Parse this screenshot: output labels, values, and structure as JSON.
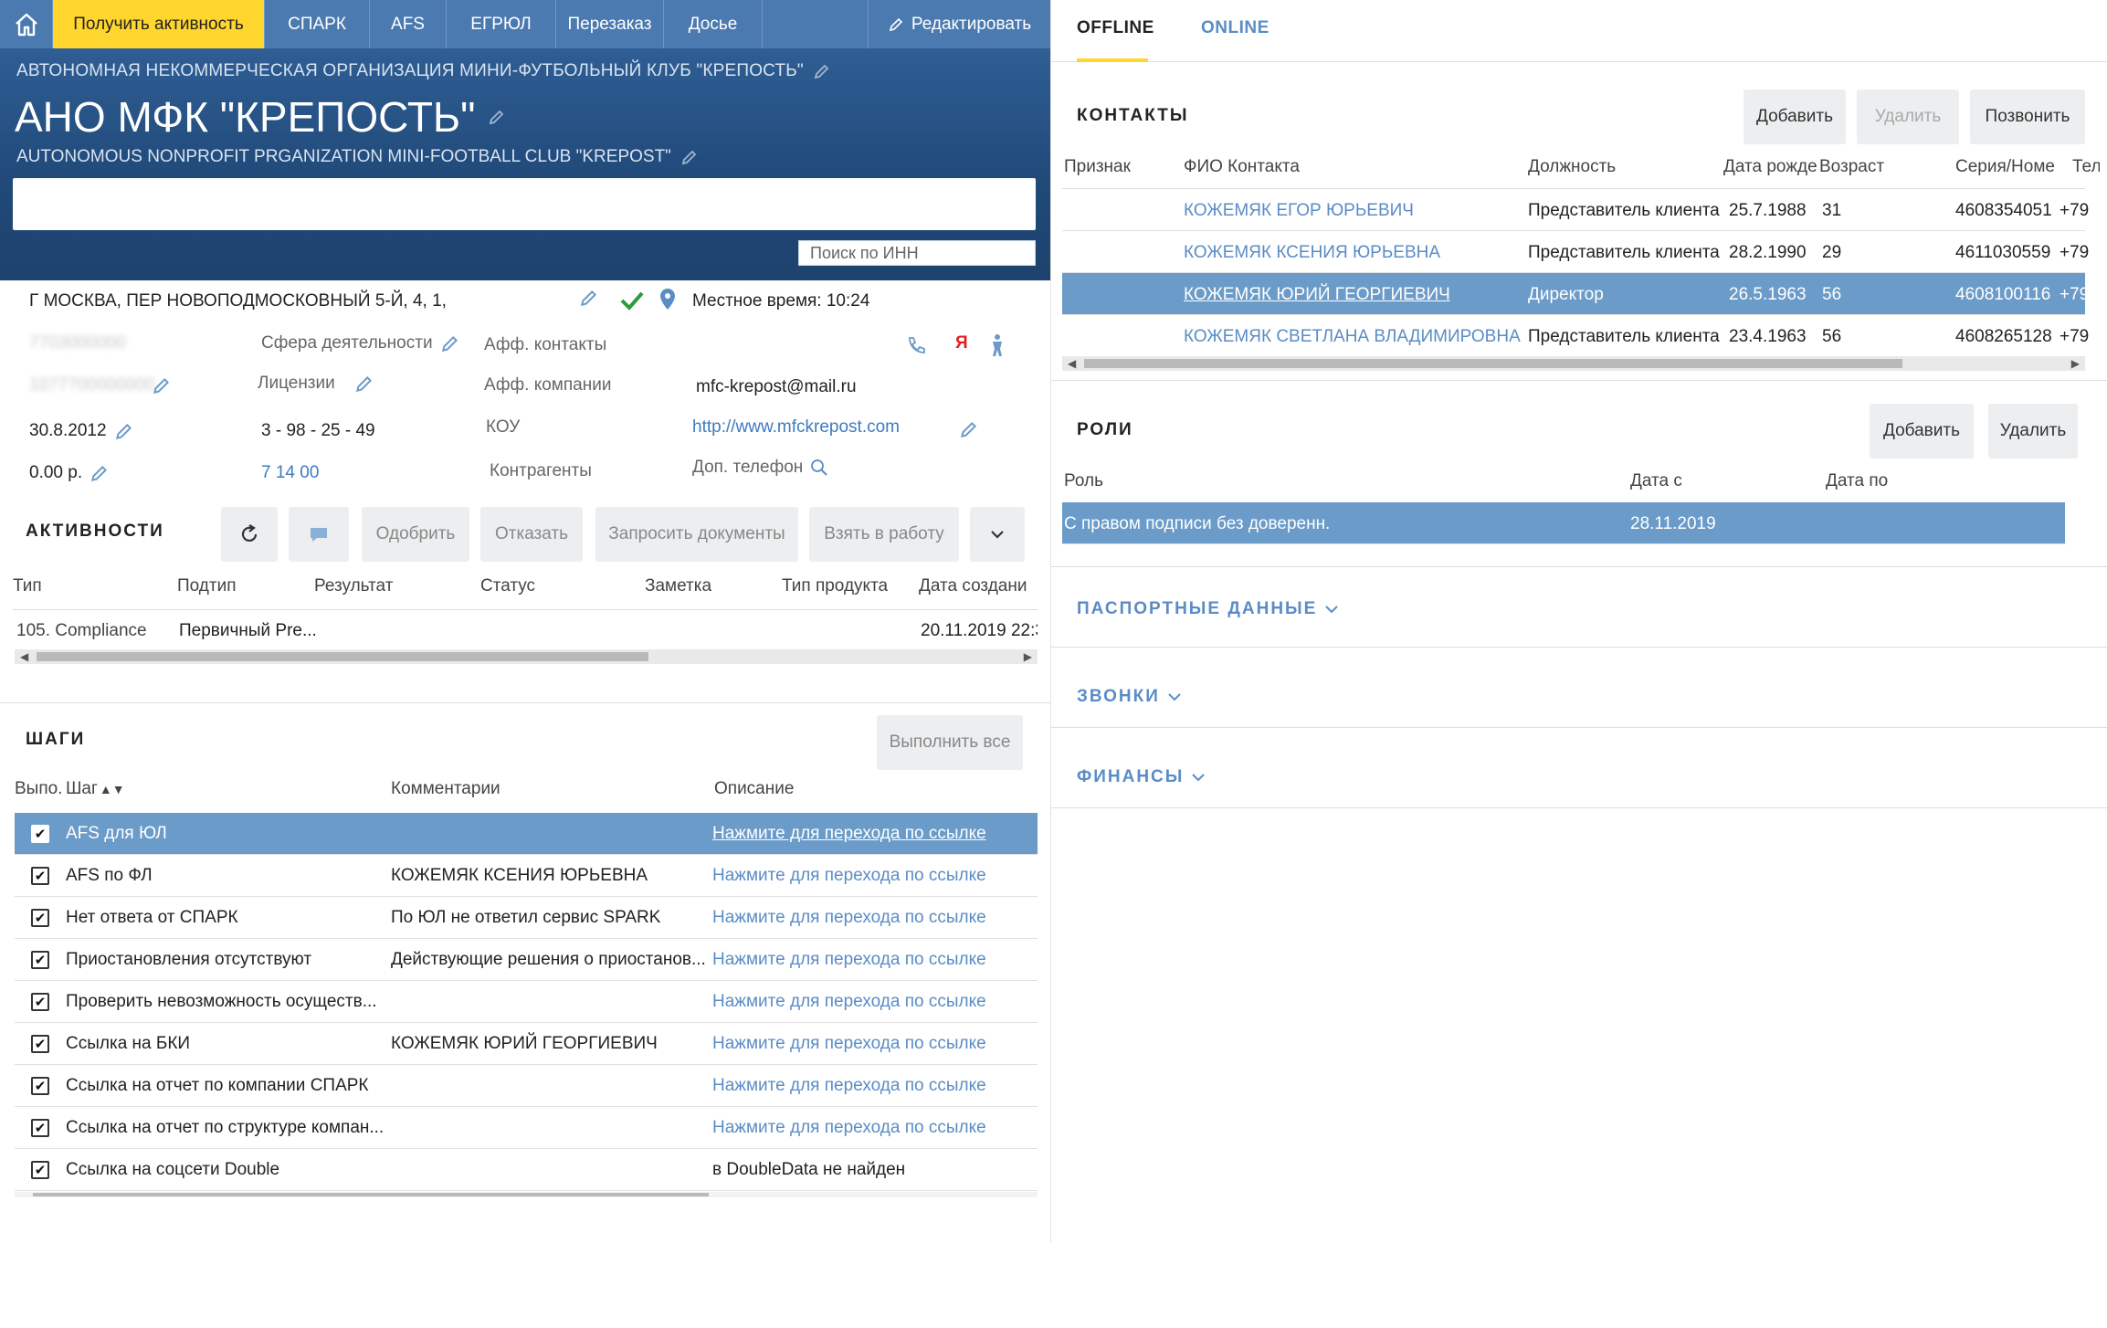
{
  "topnav": {
    "get_activity": "Получить активность",
    "items": [
      "СПАРК",
      "AFS",
      "ЕГРЮЛ",
      "Перезаказ",
      "Досье"
    ],
    "edit": "Редактировать"
  },
  "header": {
    "full_name": "АВТОНОМНАЯ НЕКОММЕРЧЕСКАЯ ОРГАНИЗАЦИЯ МИНИ-ФУТБОЛЬНЫЙ КЛУБ \"КРЕПОСТЬ\"",
    "short_name": "АНО МФК \"КРЕПОСТЬ\"",
    "english_name": "AUTONOMOUS NONPROFIT PRGANIZATION MINI-FOOTBALL CLUB \"KREPOST\"",
    "inn_search_placeholder": "Поиск по ИНН"
  },
  "info": {
    "address": "Г МОСКВА, ПЕР НОВОПОДМОСКОВНЫЙ 5-Й, 4, 1,",
    "local_time": "Местное время: 10:24",
    "blurred_1": "7703000000",
    "blurred_2": "1077700000000",
    "date": "30.8.2012",
    "amount": "0.00 р.",
    "sphere": "Сфера деятельности",
    "licenses": "Лицензии",
    "code": "3 - 98 - 25 - 49",
    "okved": "7 14 00",
    "aff_contacts": "Афф. контакты",
    "aff_companies": "Афф. компании",
    "kou": "КОУ",
    "counterparties": "Контрагенты",
    "email": "mfc-krepost@mail.ru",
    "website": "http://www.mfckrepost.com",
    "extra_phone": "Доп. телефон"
  },
  "activities": {
    "title": "АКТИВНОСТИ",
    "buttons": {
      "approve": "Одобрить",
      "reject": "Отказать",
      "request_docs": "Запросить документы",
      "take": "Взять в работу"
    },
    "columns": [
      "Тип",
      "Подтип",
      "Результат",
      "Статус",
      "Заметка",
      "Тип продукта",
      "Дата создани"
    ],
    "rows": [
      {
        "type": "105. Compliance",
        "subtype": "Первичный Pre...",
        "created": "20.11.2019 22:3"
      }
    ]
  },
  "steps": {
    "title": "ШАГИ",
    "execute_all": "Выполнить все",
    "columns": [
      "Выпо.",
      "Шаг",
      "Комментарии",
      "Описание"
    ],
    "rows": [
      {
        "step": "AFS для ЮЛ",
        "comment": "",
        "description": "Нажмите для перехода по ссылке",
        "is_link": true,
        "selected": true
      },
      {
        "step": "AFS по ФЛ",
        "comment": "КОЖЕМЯК КСЕНИЯ ЮРЬЕВНА",
        "description": "Нажмите для перехода по ссылке",
        "is_link": true
      },
      {
        "step": "Нет ответа от СПАРК",
        "comment": "По ЮЛ не ответил сервис SPARK",
        "description": "Нажмите для перехода по ссылке",
        "is_link": true
      },
      {
        "step": "Приостановления отсутствуют",
        "comment": "Действующие решения о приостанов...",
        "description": "Нажмите для перехода по ссылке",
        "is_link": true
      },
      {
        "step": "Проверить невозможность осуществ...",
        "comment": "",
        "description": "Нажмите для перехода по ссылке",
        "is_link": true
      },
      {
        "step": "Ссылка на БКИ",
        "comment": "КОЖЕМЯК ЮРИЙ ГЕОРГИЕВИЧ",
        "description": "Нажмите для перехода по ссылке",
        "is_link": true
      },
      {
        "step": "Ссылка на отчет по компании СПАРК",
        "comment": "",
        "description": "Нажмите для перехода по ссылке",
        "is_link": true
      },
      {
        "step": "Ссылка на отчет по структуре компан...",
        "comment": "",
        "description": "Нажмите для перехода по ссылке",
        "is_link": true
      },
      {
        "step": "Ссылка на соцсети Double",
        "comment": "",
        "description": "в DoubleData не найден",
        "is_link": false
      }
    ]
  },
  "tabs": {
    "offline": "OFFLINE",
    "online": "ONLINE"
  },
  "contacts": {
    "title": "КОНТАКТЫ",
    "buttons": {
      "add": "Добавить",
      "delete": "Удалить",
      "call": "Позвонить"
    },
    "columns": [
      "Признак",
      "ФИО Контакта",
      "Должность",
      "Дата рожде",
      "Возраст",
      "Серия/Номе",
      "Тел"
    ],
    "rows": [
      {
        "name": "КОЖЕМЯК ЕГОР ЮРЬЕВИЧ",
        "position": "Представитель клиента",
        "birth": "25.7.1988",
        "age": "31",
        "passport": "4608354051",
        "phone": "+79"
      },
      {
        "name": "КОЖЕМЯК КСЕНИЯ ЮРЬЕВНА",
        "position": "Представитель клиента",
        "birth": "28.2.1990",
        "age": "29",
        "passport": "4611030559",
        "phone": "+79"
      },
      {
        "name": "КОЖЕМЯК ЮРИЙ ГЕОРГИЕВИЧ",
        "position": "Директор",
        "birth": "26.5.1963",
        "age": "56",
        "passport": "4608100116",
        "phone": "+79",
        "selected": true
      },
      {
        "name": "КОЖЕМЯК СВЕТЛАНА ВЛАДИМИРОВНА",
        "position": "Представитель клиента",
        "birth": "23.4.1963",
        "age": "56",
        "passport": "4608265128",
        "phone": "+79"
      }
    ]
  },
  "roles": {
    "title": "РОЛИ",
    "buttons": {
      "add": "Добавить",
      "delete": "Удалить"
    },
    "columns": [
      "Роль",
      "Дата с",
      "Дата по"
    ],
    "rows": [
      {
        "role": "С правом подписи без доверенн.",
        "from": "28.11.2019",
        "to": ""
      }
    ]
  },
  "sections": {
    "passport": "ПАСПОРТНЫЕ ДАННЫЕ",
    "calls": "ЗВОНКИ",
    "finance": "ФИНАНСЫ"
  },
  "colors": {
    "accent_yellow": "#ffd62e",
    "nav_blue": "#4a7ab0",
    "header_blue": "#214a7a",
    "selected_row": "#6b9bc8",
    "link": "#5a8cc6",
    "ok_green": "#2e9b3c",
    "yandex_red": "#e02020"
  }
}
